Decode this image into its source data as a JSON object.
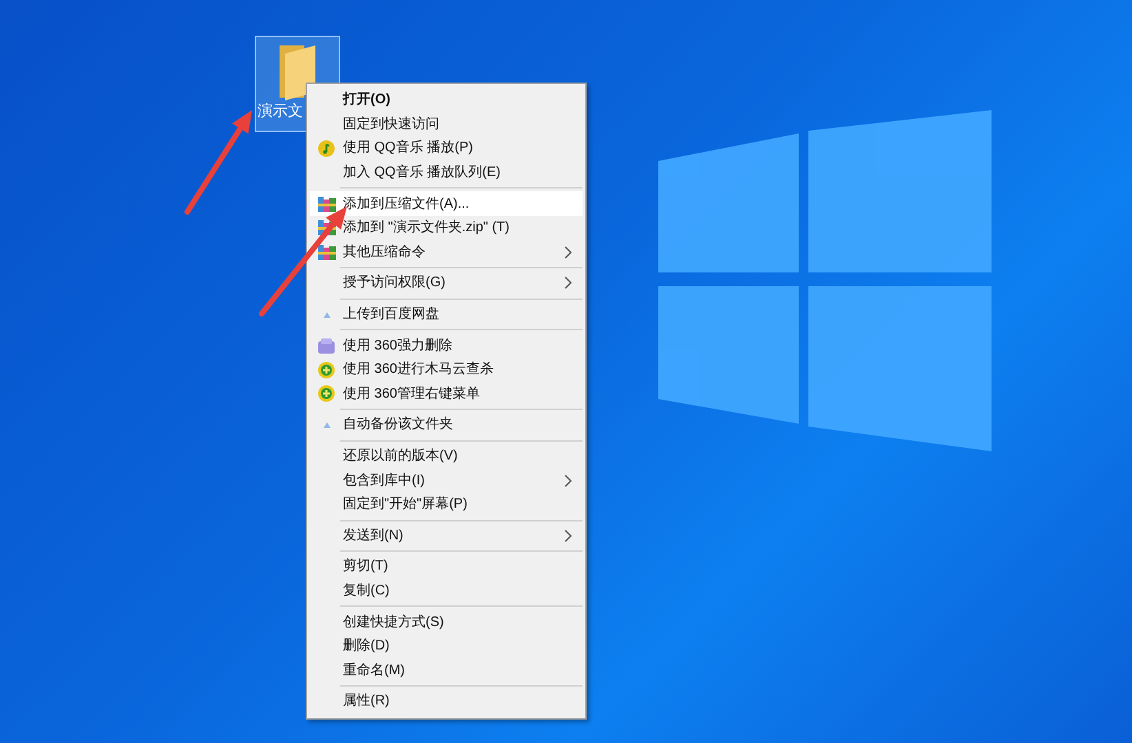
{
  "desktop_icon": {
    "label": "演示文",
    "selected": true
  },
  "context_menu": {
    "groups": [
      {
        "items": [
          {
            "label": "打开(O)",
            "bold": true,
            "kind": "none",
            "submenu": false,
            "selected": false
          },
          {
            "label": "固定到快速访问",
            "bold": false,
            "kind": "none",
            "submenu": false,
            "selected": false
          },
          {
            "label": "使用 QQ音乐 播放(P)",
            "bold": false,
            "kind": "music",
            "submenu": false,
            "selected": false
          },
          {
            "label": "加入 QQ音乐 播放队列(E)",
            "bold": false,
            "kind": "none",
            "submenu": false,
            "selected": false
          }
        ]
      },
      {
        "items": [
          {
            "label": "添加到压缩文件(A)...",
            "bold": false,
            "kind": "archive",
            "submenu": false,
            "selected": true
          },
          {
            "label": "添加到 \"演示文件夹.zip\" (T)",
            "bold": false,
            "kind": "archive",
            "submenu": false,
            "selected": false
          },
          {
            "label": "其他压缩命令",
            "bold": false,
            "kind": "archive",
            "submenu": true,
            "selected": false
          }
        ]
      },
      {
        "items": [
          {
            "label": "授予访问权限(G)",
            "bold": false,
            "kind": "none",
            "submenu": true,
            "selected": false
          }
        ]
      },
      {
        "items": [
          {
            "label": "上传到百度网盘",
            "bold": false,
            "kind": "dot",
            "submenu": false,
            "selected": false
          }
        ]
      },
      {
        "items": [
          {
            "label": "使用 360强力删除",
            "bold": false,
            "kind": "eraser",
            "submenu": false,
            "selected": false
          },
          {
            "label": "使用 360进行木马云查杀",
            "bold": false,
            "kind": "plus",
            "submenu": false,
            "selected": false
          },
          {
            "label": "使用 360管理右键菜单",
            "bold": false,
            "kind": "plus",
            "submenu": false,
            "selected": false
          }
        ]
      },
      {
        "items": [
          {
            "label": "自动备份该文件夹",
            "bold": false,
            "kind": "dot",
            "submenu": false,
            "selected": false
          }
        ]
      },
      {
        "items": [
          {
            "label": "还原以前的版本(V)",
            "bold": false,
            "kind": "none",
            "submenu": false,
            "selected": false
          },
          {
            "label": "包含到库中(I)",
            "bold": false,
            "kind": "none",
            "submenu": true,
            "selected": false
          },
          {
            "label": "固定到\"开始\"屏幕(P)",
            "bold": false,
            "kind": "none",
            "submenu": false,
            "selected": false
          }
        ]
      },
      {
        "items": [
          {
            "label": "发送到(N)",
            "bold": false,
            "kind": "none",
            "submenu": true,
            "selected": false
          }
        ]
      },
      {
        "items": [
          {
            "label": "剪切(T)",
            "bold": false,
            "kind": "none",
            "submenu": false,
            "selected": false
          },
          {
            "label": "复制(C)",
            "bold": false,
            "kind": "none",
            "submenu": false,
            "selected": false
          }
        ]
      },
      {
        "items": [
          {
            "label": "创建快捷方式(S)",
            "bold": false,
            "kind": "none",
            "submenu": false,
            "selected": false
          },
          {
            "label": "删除(D)",
            "bold": false,
            "kind": "none",
            "submenu": false,
            "selected": false
          },
          {
            "label": "重命名(M)",
            "bold": false,
            "kind": "none",
            "submenu": false,
            "selected": false
          }
        ]
      },
      {
        "items": [
          {
            "label": "属性(R)",
            "bold": false,
            "kind": "none",
            "submenu": false,
            "selected": false
          }
        ]
      }
    ]
  }
}
